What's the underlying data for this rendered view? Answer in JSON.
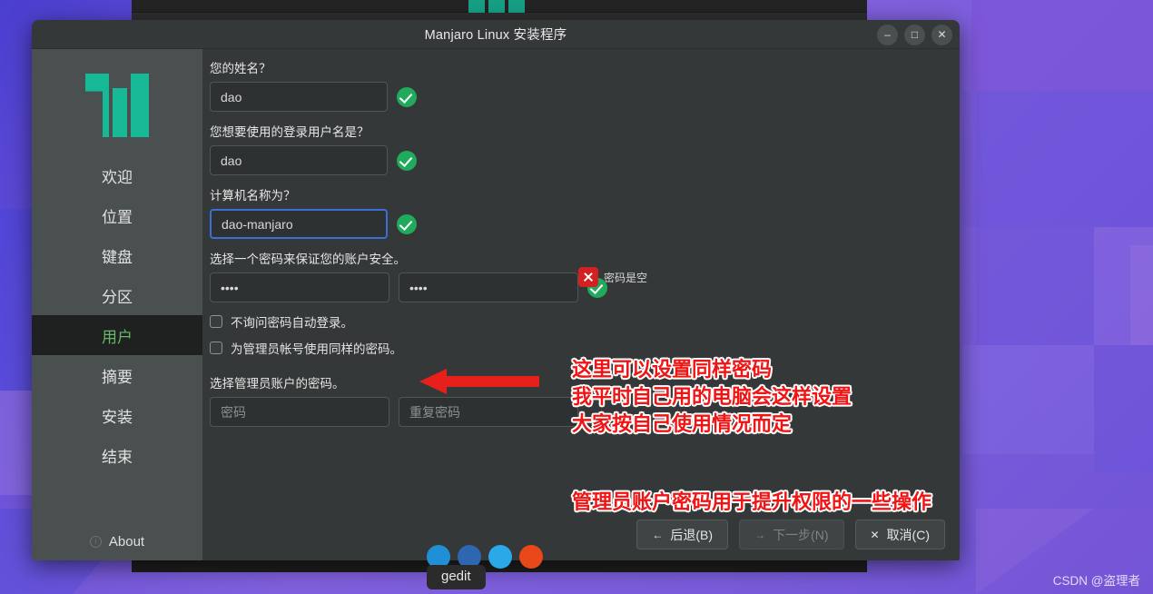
{
  "window": {
    "title": "Manjaro Linux 安装程序",
    "controls": {
      "minimize": "–",
      "maximize": "□",
      "close": "✕"
    }
  },
  "sidebar": {
    "logo": "manjaro-logo",
    "items": [
      {
        "label": "欢迎",
        "active": false
      },
      {
        "label": "位置",
        "active": false
      },
      {
        "label": "键盘",
        "active": false
      },
      {
        "label": "分区",
        "active": false
      },
      {
        "label": "用户",
        "active": true
      },
      {
        "label": "摘要",
        "active": false
      },
      {
        "label": "安装",
        "active": false
      },
      {
        "label": "结束",
        "active": false
      }
    ],
    "about_label": "About",
    "about_icon": "info-icon"
  },
  "form": {
    "fullname": {
      "label": "您的姓名？",
      "value": "dao",
      "placeholder": "",
      "valid_icon": "check-circle-icon"
    },
    "username": {
      "label": "您想要使用的登录用户名是？",
      "value": "dao",
      "placeholder": "",
      "valid_icon": "check-circle-icon"
    },
    "hostname": {
      "label": "计算机名称为？",
      "value": "dao-manjaro",
      "placeholder": "",
      "focused": true,
      "valid_icon": "check-circle-icon"
    },
    "user_password": {
      "label": "选择一个密码来保证您的账户安全。",
      "value": "••••",
      "repeat_value": "••••",
      "placeholder": "",
      "repeat_placeholder": "",
      "valid_icon": "check-circle-icon"
    },
    "checkboxes": [
      {
        "label": "不询问密码自动登录。",
        "checked": false
      },
      {
        "label": "为管理员帐号使用同样的密码。",
        "checked": false
      }
    ],
    "admin_password": {
      "label": "选择管理员账户的密码。",
      "value": "",
      "repeat_value": "",
      "placeholder": "密码",
      "repeat_placeholder": "重复密码",
      "error_text": "密码是空",
      "error_icon": "error-x-icon"
    }
  },
  "footer": {
    "back": {
      "label": "后退(B)",
      "icon": "arrow-left-icon",
      "disabled": false
    },
    "next": {
      "label": "下一步(N)",
      "icon": "arrow-right-icon",
      "disabled": true
    },
    "cancel": {
      "label": "取消(C)",
      "icon": "close-x-icon",
      "disabled": false
    }
  },
  "annotations": {
    "arrow": "red-left-arrow",
    "lines": [
      "这里可以设置同样密码",
      "我平时自己用的电脑会这样设置",
      "大家按自己使用情况而定"
    ],
    "bottom_line": "管理员账户密码用于提升权限的一些操作"
  },
  "dock": {
    "tooltip": "gedit",
    "icons": [
      "app-icon-1",
      "app-icon-2",
      "app-icon-3",
      "app-icon-4"
    ]
  },
  "watermark": "CSDN @盗理者",
  "colors": {
    "accent_green": "#16b896",
    "valid_green": "#20ab5c",
    "error_red": "#d32020",
    "annotation_red": "#f01414",
    "focus_blue": "#3b6fd4",
    "active_nav_text": "#68b868"
  }
}
